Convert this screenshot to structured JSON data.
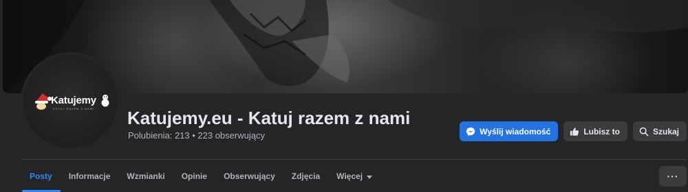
{
  "page": {
    "name": "Katujemy.eu - Katuj razem z nami",
    "stats": "Polubienia: 213 • 223 obserwujący",
    "logo_text": "Katujemy",
    "logo_subtext": "KATUJ RAZEM Z NAMI"
  },
  "actions": {
    "message_label": "Wyślij wiadomość",
    "like_label": "Lubisz to",
    "search_label": "Szukaj"
  },
  "tabs": [
    {
      "label": "Posty"
    },
    {
      "label": "Informacje"
    },
    {
      "label": "Wzmianki"
    },
    {
      "label": "Opinie"
    },
    {
      "label": "Obserwujący"
    },
    {
      "label": "Zdjęcia"
    },
    {
      "label": "Więcej"
    }
  ],
  "more_menu": {
    "label": "···"
  },
  "colors": {
    "accent": "#2374e1",
    "tab_active": "#2d88ff",
    "background": "#242526",
    "button": "#3a3b3c"
  },
  "icons": {
    "message": "messenger-icon",
    "like": "thumbs-up-icon",
    "search": "search-icon",
    "more_tabs": "caret-down-icon",
    "overflow": "more-horizontal-icon"
  }
}
